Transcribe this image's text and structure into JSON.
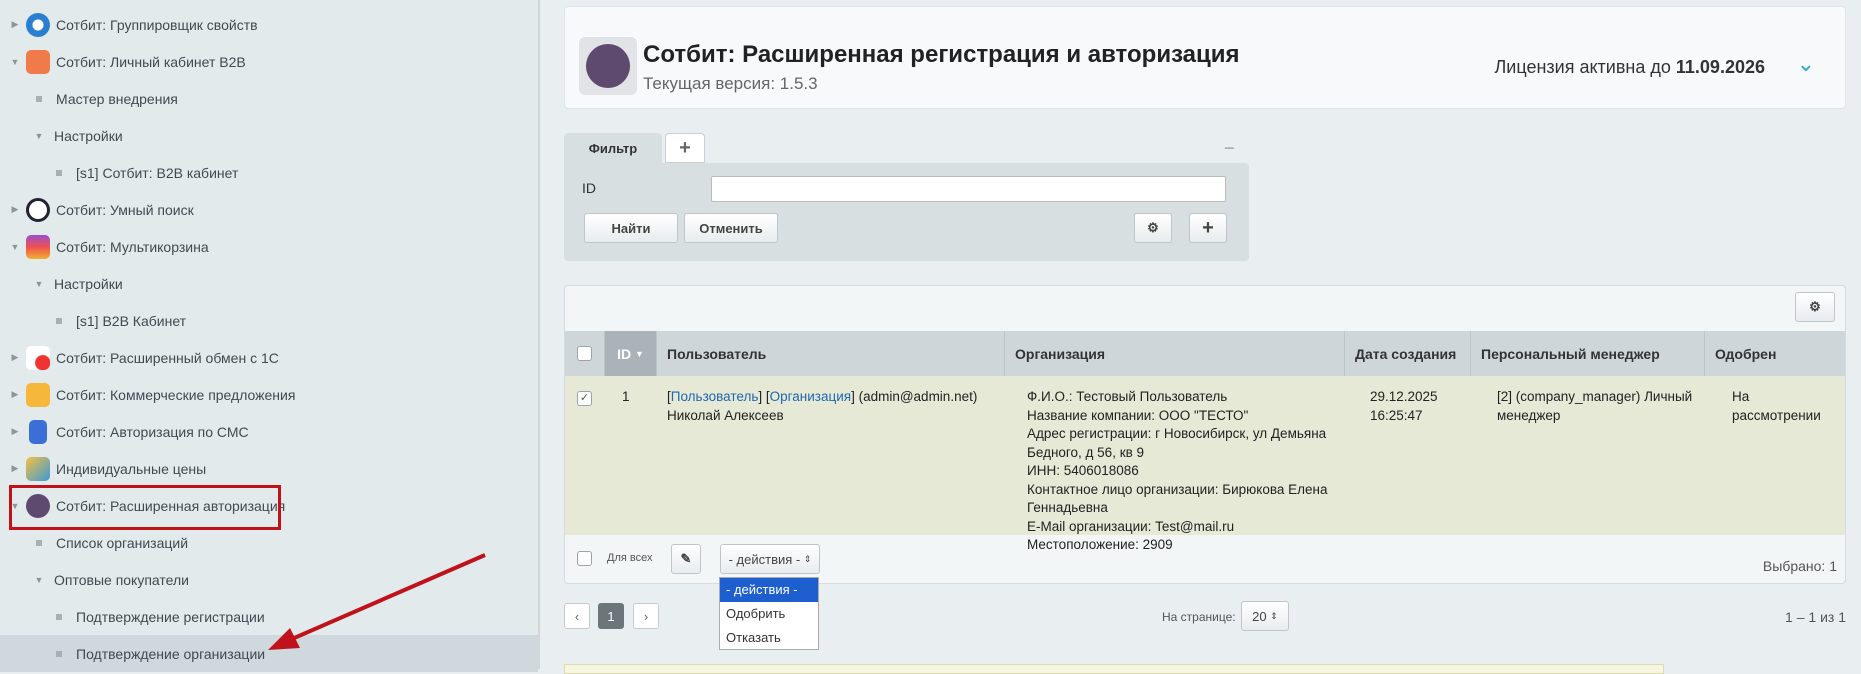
{
  "sidebar": {
    "items": [
      {
        "label": "Сотбит: Группировщик свойств"
      },
      {
        "label": "Сотбит: Личный кабинет B2B"
      },
      {
        "label": "Мастер внедрения"
      },
      {
        "label": "Настройки"
      },
      {
        "label": "[s1] Сотбит: B2B кабинет"
      },
      {
        "label": "Сотбит: Умный поиск"
      },
      {
        "label": "Сотбит: Мультикорзина"
      },
      {
        "label": "Настройки"
      },
      {
        "label": "[s1] B2B Кабинет"
      },
      {
        "label": "Сотбит: Расширенный обмен с 1С"
      },
      {
        "label": "Сотбит: Коммерческие предложения"
      },
      {
        "label": "Сотбит: Авторизация по СМС"
      },
      {
        "label": "Индивидуальные цены"
      },
      {
        "label": "Сотбит: Расширенная авторизация"
      },
      {
        "label": "Список организаций"
      },
      {
        "label": "Оптовые покупатели"
      },
      {
        "label": "Подтверждение регистрации"
      },
      {
        "label": "Подтверждение организации"
      }
    ]
  },
  "header": {
    "title": "Сотбит: Расширенная регистрация и авторизация",
    "version": "Текущая версия: 1.5.3",
    "license_prefix": "Лицензия активна до ",
    "license_date": "11.09.2026"
  },
  "filter": {
    "tab": "Фильтр",
    "add_tab": "+",
    "collapse": "−",
    "id_label": "ID",
    "id_value": "",
    "find": "Найти",
    "cancel": "Отменить",
    "add": "+"
  },
  "table": {
    "columns": [
      "ID",
      "Пользователь",
      "Организация",
      "Дата создания",
      "Персональный менеджер",
      "Одобрен"
    ],
    "row": {
      "id": "1",
      "user_link1": "Пользователь",
      "user_link2": "Организация",
      "user_email": "(admin@admin.net)",
      "user_name": "Николай Алексеев",
      "org": [
        "Ф.И.О.: Тестовый Пользователь",
        "Название компании: ООО \"ТЕСТО\"",
        "Адрес регистрации: г Новосибирск, ул Демьяна",
        "Бедного, д 56, кв 9",
        "ИНН: 5406018086",
        "Контактное лицо организации: Бирюкова Елена",
        "Геннадьевна",
        "E-Mail организации: Test@mail.ru",
        "Местоположение: 2909"
      ],
      "date": "29.12.2025",
      "time": "16:25:47",
      "manager": "[2] (company_manager) Личный менеджер",
      "approved": "На рассмотрении"
    },
    "for_all": "Для всех",
    "actions": "- действия -",
    "selected": "Выбрано: 1"
  },
  "dropdown": {
    "options": [
      "- действия -",
      "Одобрить",
      "Отказать"
    ]
  },
  "pager": {
    "page": "1",
    "per_page_label": "На странице:",
    "per_page": "20",
    "range": "1 – 1 из 1"
  }
}
